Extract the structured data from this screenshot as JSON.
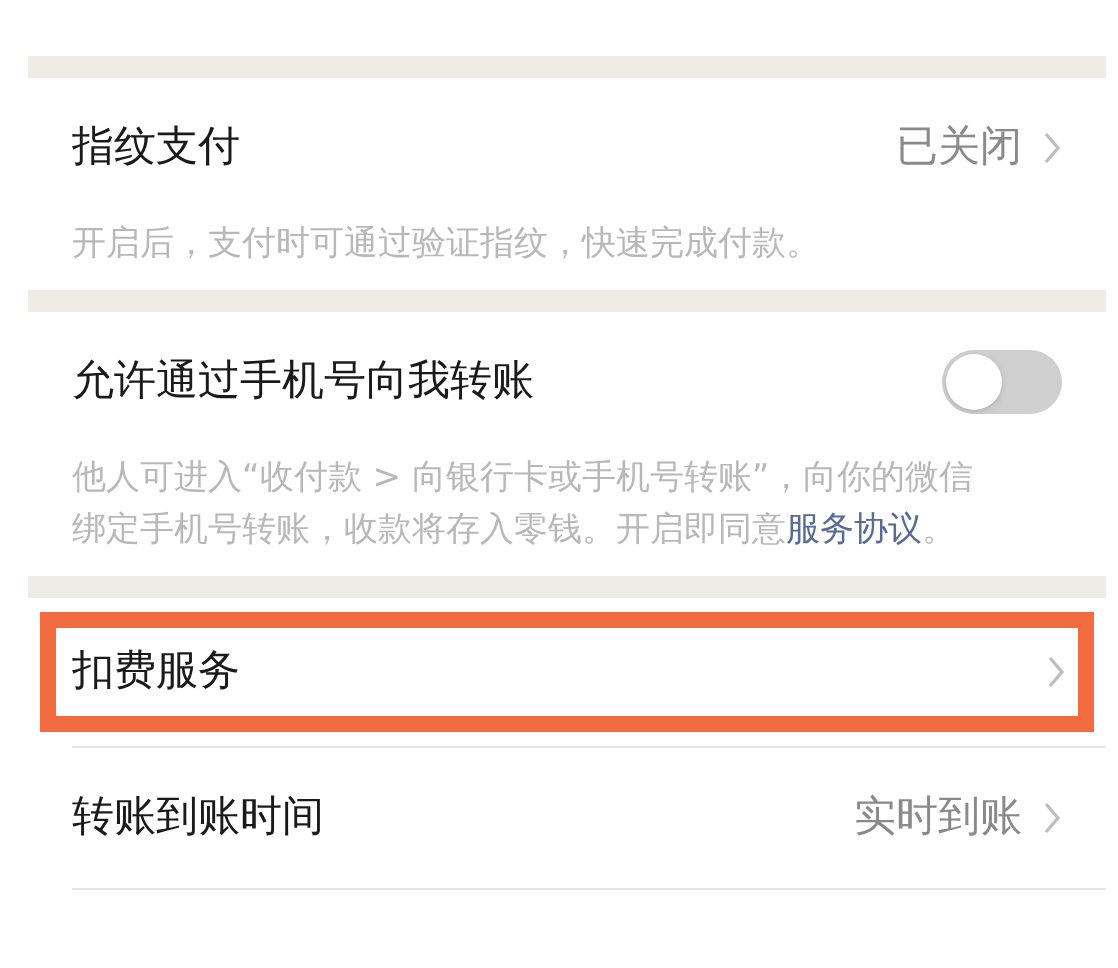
{
  "sections": [
    {
      "items": [
        {
          "kind": "link",
          "label": "指纹支付",
          "value": "已关闭",
          "highlighted": false
        }
      ],
      "note": "开启后，支付时可通过验证指纹，快速完成付款。"
    },
    {
      "items": [
        {
          "kind": "toggle",
          "label": "允许通过手机号向我转账",
          "on": false
        }
      ],
      "note": "他人可进入“收付款 > 向银行卡或手机号转账”，向你的微信绑定手机号转账，收款将存入零钱。开启即同意",
      "note_link": "服务协议",
      "note_end": "。"
    },
    {
      "items": [
        {
          "kind": "link",
          "label": "扣费服务",
          "highlighted": true
        },
        {
          "kind": "link",
          "label": "转账到账时间",
          "value": "实时到账",
          "highlighted": false
        }
      ]
    }
  ]
}
